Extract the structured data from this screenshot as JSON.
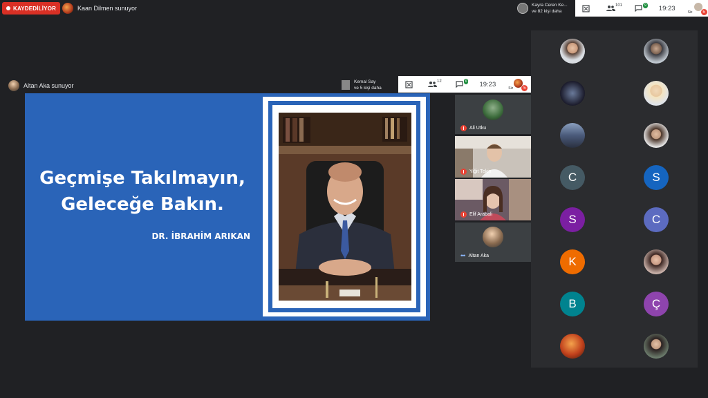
{
  "recording": {
    "label": "KAYDEDİLİYOR"
  },
  "outer_presenter": {
    "text": "Kaan Dilmen sunuyor"
  },
  "outer_topbar": {
    "viewers_text_line1": "Kayra Ceren Ke...",
    "viewers_text_line2": "ve 82 kişi daha",
    "people_count": "101",
    "chat_count": "9",
    "time": "19:23",
    "self_label": "Siz",
    "self_badge": "5"
  },
  "inner_presenter": {
    "text": "Altan Aka sunuyor"
  },
  "inner_topbar": {
    "viewers_text_line1": "Kemal Say",
    "viewers_text_line2": "ve 5 kişi daha",
    "people_count": "12",
    "chat_count": "6",
    "time": "19:23",
    "self_label": "Siz",
    "self_badge": "5"
  },
  "slide": {
    "line1": "Geçmişe Takılmayın,",
    "line2": "Geleceğe Bakın.",
    "author": "DR. İBRAHİM ARIKAN"
  },
  "inner_participants": [
    {
      "name": "Ali Utku",
      "muted": true
    },
    {
      "name": "Yiğit Tekin",
      "muted": true
    },
    {
      "name": "Elif Arabali",
      "muted": true
    },
    {
      "name": "Altan Aka",
      "muted": false
    }
  ],
  "grid_letters": {
    "c1": "C",
    "s1": "S",
    "s2": "S",
    "c2": "C",
    "k": "K",
    "b": "B",
    "cc": "Ç"
  },
  "colors": {
    "recording_red": "#d93025",
    "slide_blue": "#2a64b8",
    "avatar_slate": "#455a64",
    "avatar_blue": "#1565c0",
    "avatar_purple": "#7b1fa2",
    "avatar_indigo": "#5c6bc0",
    "avatar_orange": "#ef6c00",
    "avatar_teal": "#00838f",
    "avatar_violet": "#8e44ad"
  }
}
